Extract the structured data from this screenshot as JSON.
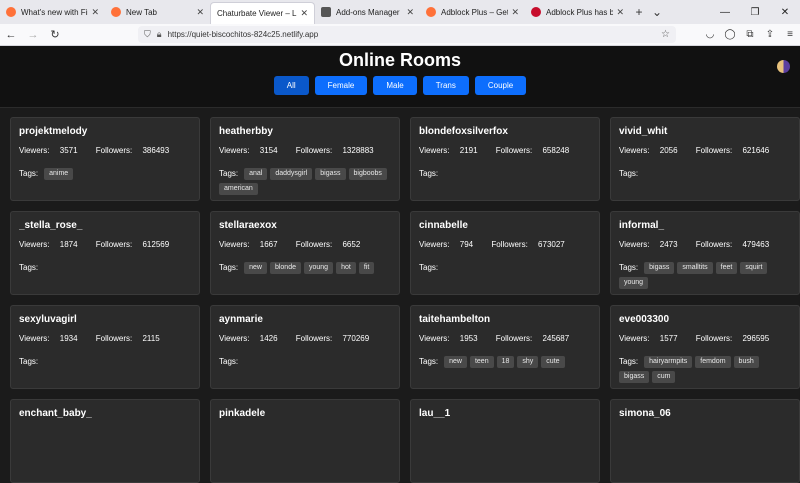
{
  "browser": {
    "tabs": [
      {
        "title": "What's new with Firefox",
        "color": "#ff7139",
        "active": false
      },
      {
        "title": "New Tab",
        "color": "#ff7139",
        "active": false
      },
      {
        "title": "Chaturbate Viewer – Live Stream",
        "color": "#ffffff",
        "active": true
      },
      {
        "title": "Add-ons Manager",
        "color": "#555555",
        "active": false
      },
      {
        "title": "Adblock Plus – Get this Exte",
        "color": "#ff7139",
        "active": false
      },
      {
        "title": "Adblock Plus has been insta",
        "color": "#c70d2c",
        "active": false
      }
    ],
    "url": "https://quiet-biscochitos-824c25.netlify.app"
  },
  "page": {
    "title": "Online Rooms",
    "filters": [
      "All",
      "Female",
      "Male",
      "Trans",
      "Couple"
    ],
    "viewers_label": "Viewers:",
    "followers_label": "Followers:",
    "tags_label": "Tags:"
  },
  "rooms": [
    {
      "name": "projektmelody",
      "viewers": "3571",
      "followers": "386493",
      "tags": [
        "anime"
      ]
    },
    {
      "name": "heatherbby",
      "viewers": "3154",
      "followers": "1328883",
      "tags": [
        "anal",
        "daddysgirl",
        "bigass",
        "bigboobs",
        "american"
      ]
    },
    {
      "name": "blondefoxsilverfox",
      "viewers": "2191",
      "followers": "658248",
      "tags": []
    },
    {
      "name": "vivid_whit",
      "viewers": "2056",
      "followers": "621646",
      "tags": []
    },
    {
      "name": "_stella_rose_",
      "viewers": "1874",
      "followers": "612569",
      "tags": []
    },
    {
      "name": "stellaraexox",
      "viewers": "1667",
      "followers": "6652",
      "tags": [
        "new",
        "blonde",
        "young",
        "hot",
        "fit"
      ]
    },
    {
      "name": "cinnabelle",
      "viewers": "794",
      "followers": "673027",
      "tags": []
    },
    {
      "name": "informal_",
      "viewers": "2473",
      "followers": "479463",
      "tags": [
        "bigass",
        "smalltits",
        "feet",
        "squirt",
        "young"
      ]
    },
    {
      "name": "sexyluvagirl",
      "viewers": "1934",
      "followers": "2115",
      "tags": []
    },
    {
      "name": "aynmarie",
      "viewers": "1426",
      "followers": "770269",
      "tags": []
    },
    {
      "name": "taitehambelton",
      "viewers": "1953",
      "followers": "245687",
      "tags": [
        "new",
        "teen",
        "18",
        "shy",
        "cute"
      ]
    },
    {
      "name": "eve003300",
      "viewers": "1577",
      "followers": "296595",
      "tags": [
        "hairyarmpits",
        "femdom",
        "bush",
        "bigass",
        "cum"
      ]
    },
    {
      "name": "enchant_baby_",
      "viewers": "",
      "followers": "",
      "tags": []
    },
    {
      "name": "pinkadele",
      "viewers": "",
      "followers": "",
      "tags": []
    },
    {
      "name": "lau__1",
      "viewers": "",
      "followers": "",
      "tags": []
    },
    {
      "name": "simona_06",
      "viewers": "",
      "followers": "",
      "tags": []
    }
  ]
}
